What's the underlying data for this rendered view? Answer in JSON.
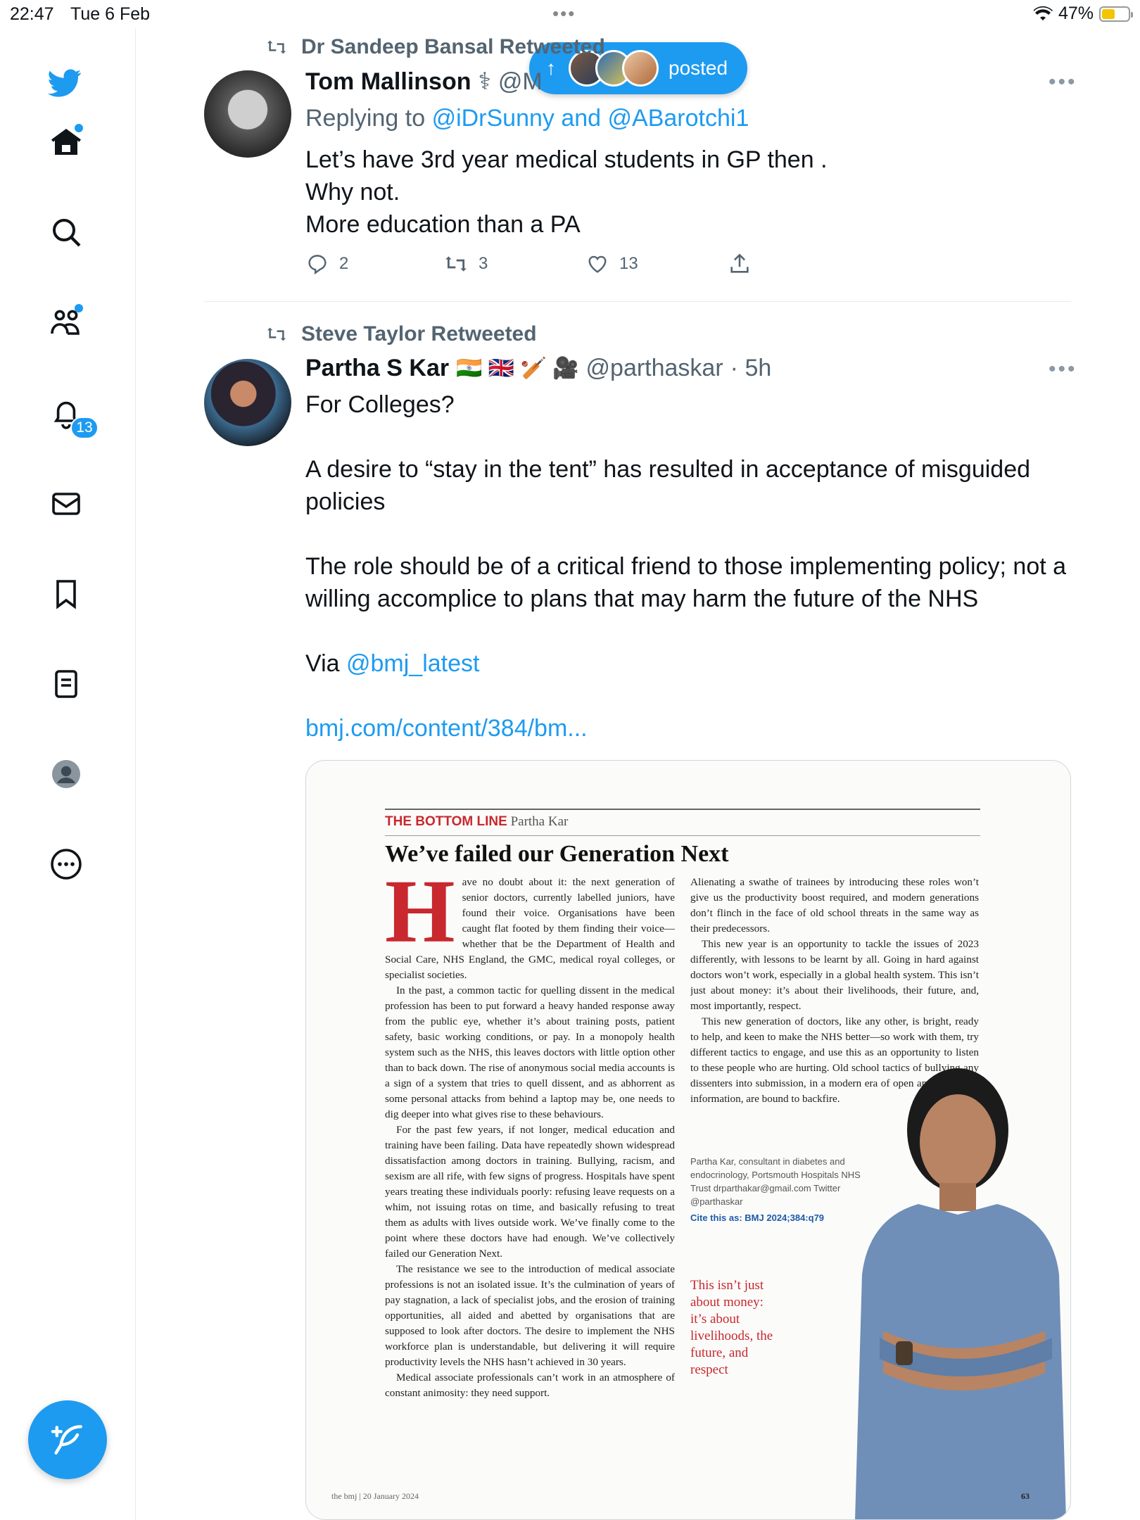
{
  "status_bar": {
    "time": "22:47",
    "date": "Tue 6 Feb",
    "battery": "47%"
  },
  "sidebar": {
    "notifications_badge": "13"
  },
  "new_posts_pill": {
    "label": "posted"
  },
  "tweet1": {
    "retweeted_by": "Dr Sandeep Bansal Retweeted",
    "name": "Tom Mallinson",
    "name_emoji": "⚕",
    "handle": "@M",
    "replying_prefix": "Replying to",
    "replying_to": "@iDrSunny and @ABarotchi1",
    "lines": [
      "Let’s have 3rd year medical students in GP then .",
      "Why not.",
      "More education than a PA"
    ],
    "replies": "2",
    "retweets": "3",
    "likes": "13"
  },
  "tweet2": {
    "retweeted_by": "Steve Taylor Retweeted",
    "name": "Partha S Kar",
    "name_flags": "🇮🇳 🇬🇧 🏏 🎥",
    "handle": "@parthaskar",
    "time": "· 5h",
    "p1": "For Colleges?",
    "p2": "A desire to “stay in the tent” has resulted in  acceptance of misguided policies",
    "p3": "The role should be of a critical friend to those implementing policy; not a willing accomplice to plans that may harm the future of the NHS",
    "via_prefix": "Via",
    "via_handle": "@bmj_latest",
    "link": "bmj.com/content/384/bm..."
  },
  "article": {
    "section": "THE BOTTOM LINE",
    "author": "Partha Kar",
    "headline": "We’ve failed our Generation Next",
    "dropcap": "H",
    "col1_lead": "ave no doubt about it: the next generation of senior doctors, currently labelled juniors, have found their voice. Organisations have been caught flat footed by them finding their voice—whether that be the Department of Health and Social Care, NHS England, the GMC, medical royal colleges, or specialist societies.",
    "col1_p2": "In the past, a common tactic for quelling dissent in the medical profession has been to put forward a heavy handed response away from the public eye, whether it’s about training posts, patient safety, basic working conditions, or pay. In a monopoly health system such as the NHS, this leaves doctors with little option other than to back down. The rise of anonymous social media accounts is a sign of a system that tries to quell dissent, and as abhorrent as some personal attacks from behind a laptop may be, one needs to dig deeper into what gives rise to these behaviours.",
    "col1_p3": "For the past few years, if not longer, medical education and training have been failing. Data have repeatedly shown widespread dissatisfaction among doctors in training. Bullying, racism, and sexism are all rife, with few signs of progress. Hospitals have spent years treating these individuals poorly: refusing leave requests on a whim, not issuing rotas on time, and basically refusing to treat them as adults with lives outside work. We’ve finally come to the point where these doctors have had enough. We’ve collectively failed our Generation Next.",
    "col1_p4": "The resistance we see to the introduction of medical associate professions is not an isolated issue. It’s the culmination of years of pay stagnation, a lack of specialist jobs, and the erosion of training opportunities, all aided and abetted by organisations that are supposed to look after doctors. The desire to implement the NHS workforce plan is understandable, but delivering it will require productivity levels the NHS hasn’t achieved in 30 years.",
    "col1_p5": "Medical associate professionals can’t work in an atmosphere of constant animosity: they need support.",
    "col2_p1": "Alienating a swathe of trainees by introducing these roles won’t give us the productivity boost required, and modern generations don’t flinch in the face of old school threats in the same way as their predecessors.",
    "col2_p2": "This new year is an opportunity to tackle the issues of 2023 differently, with lessons to be learnt by all. Going in hard against doctors won’t work, especially in a global health system. This isn’t just about money: it’s about their livelihoods, their future, and, most importantly, respect.",
    "col2_p3": "This new generation of doctors, like any other, is bright, ready to help, and keen to make the NHS better—so work with them, try different tactics to engage, and use this as an opportunity to listen to these people who are hurting. Old school tactics of bullying any dissenters into submission, in a modern era of open and accessible information, are bound to backfire.",
    "bio": "Partha Kar, consultant in diabetes and endocrinology, Portsmouth Hospitals NHS Trust drparthakar@gmail.com Twitter @parthaskar",
    "cite": "Cite this as: BMJ 2024;384:q79",
    "pullquote": "This isn’t just about money: it’s about livelihoods, the future, and respect",
    "footer_left": "the bmj | 20 January 2024",
    "page_number": "63"
  }
}
